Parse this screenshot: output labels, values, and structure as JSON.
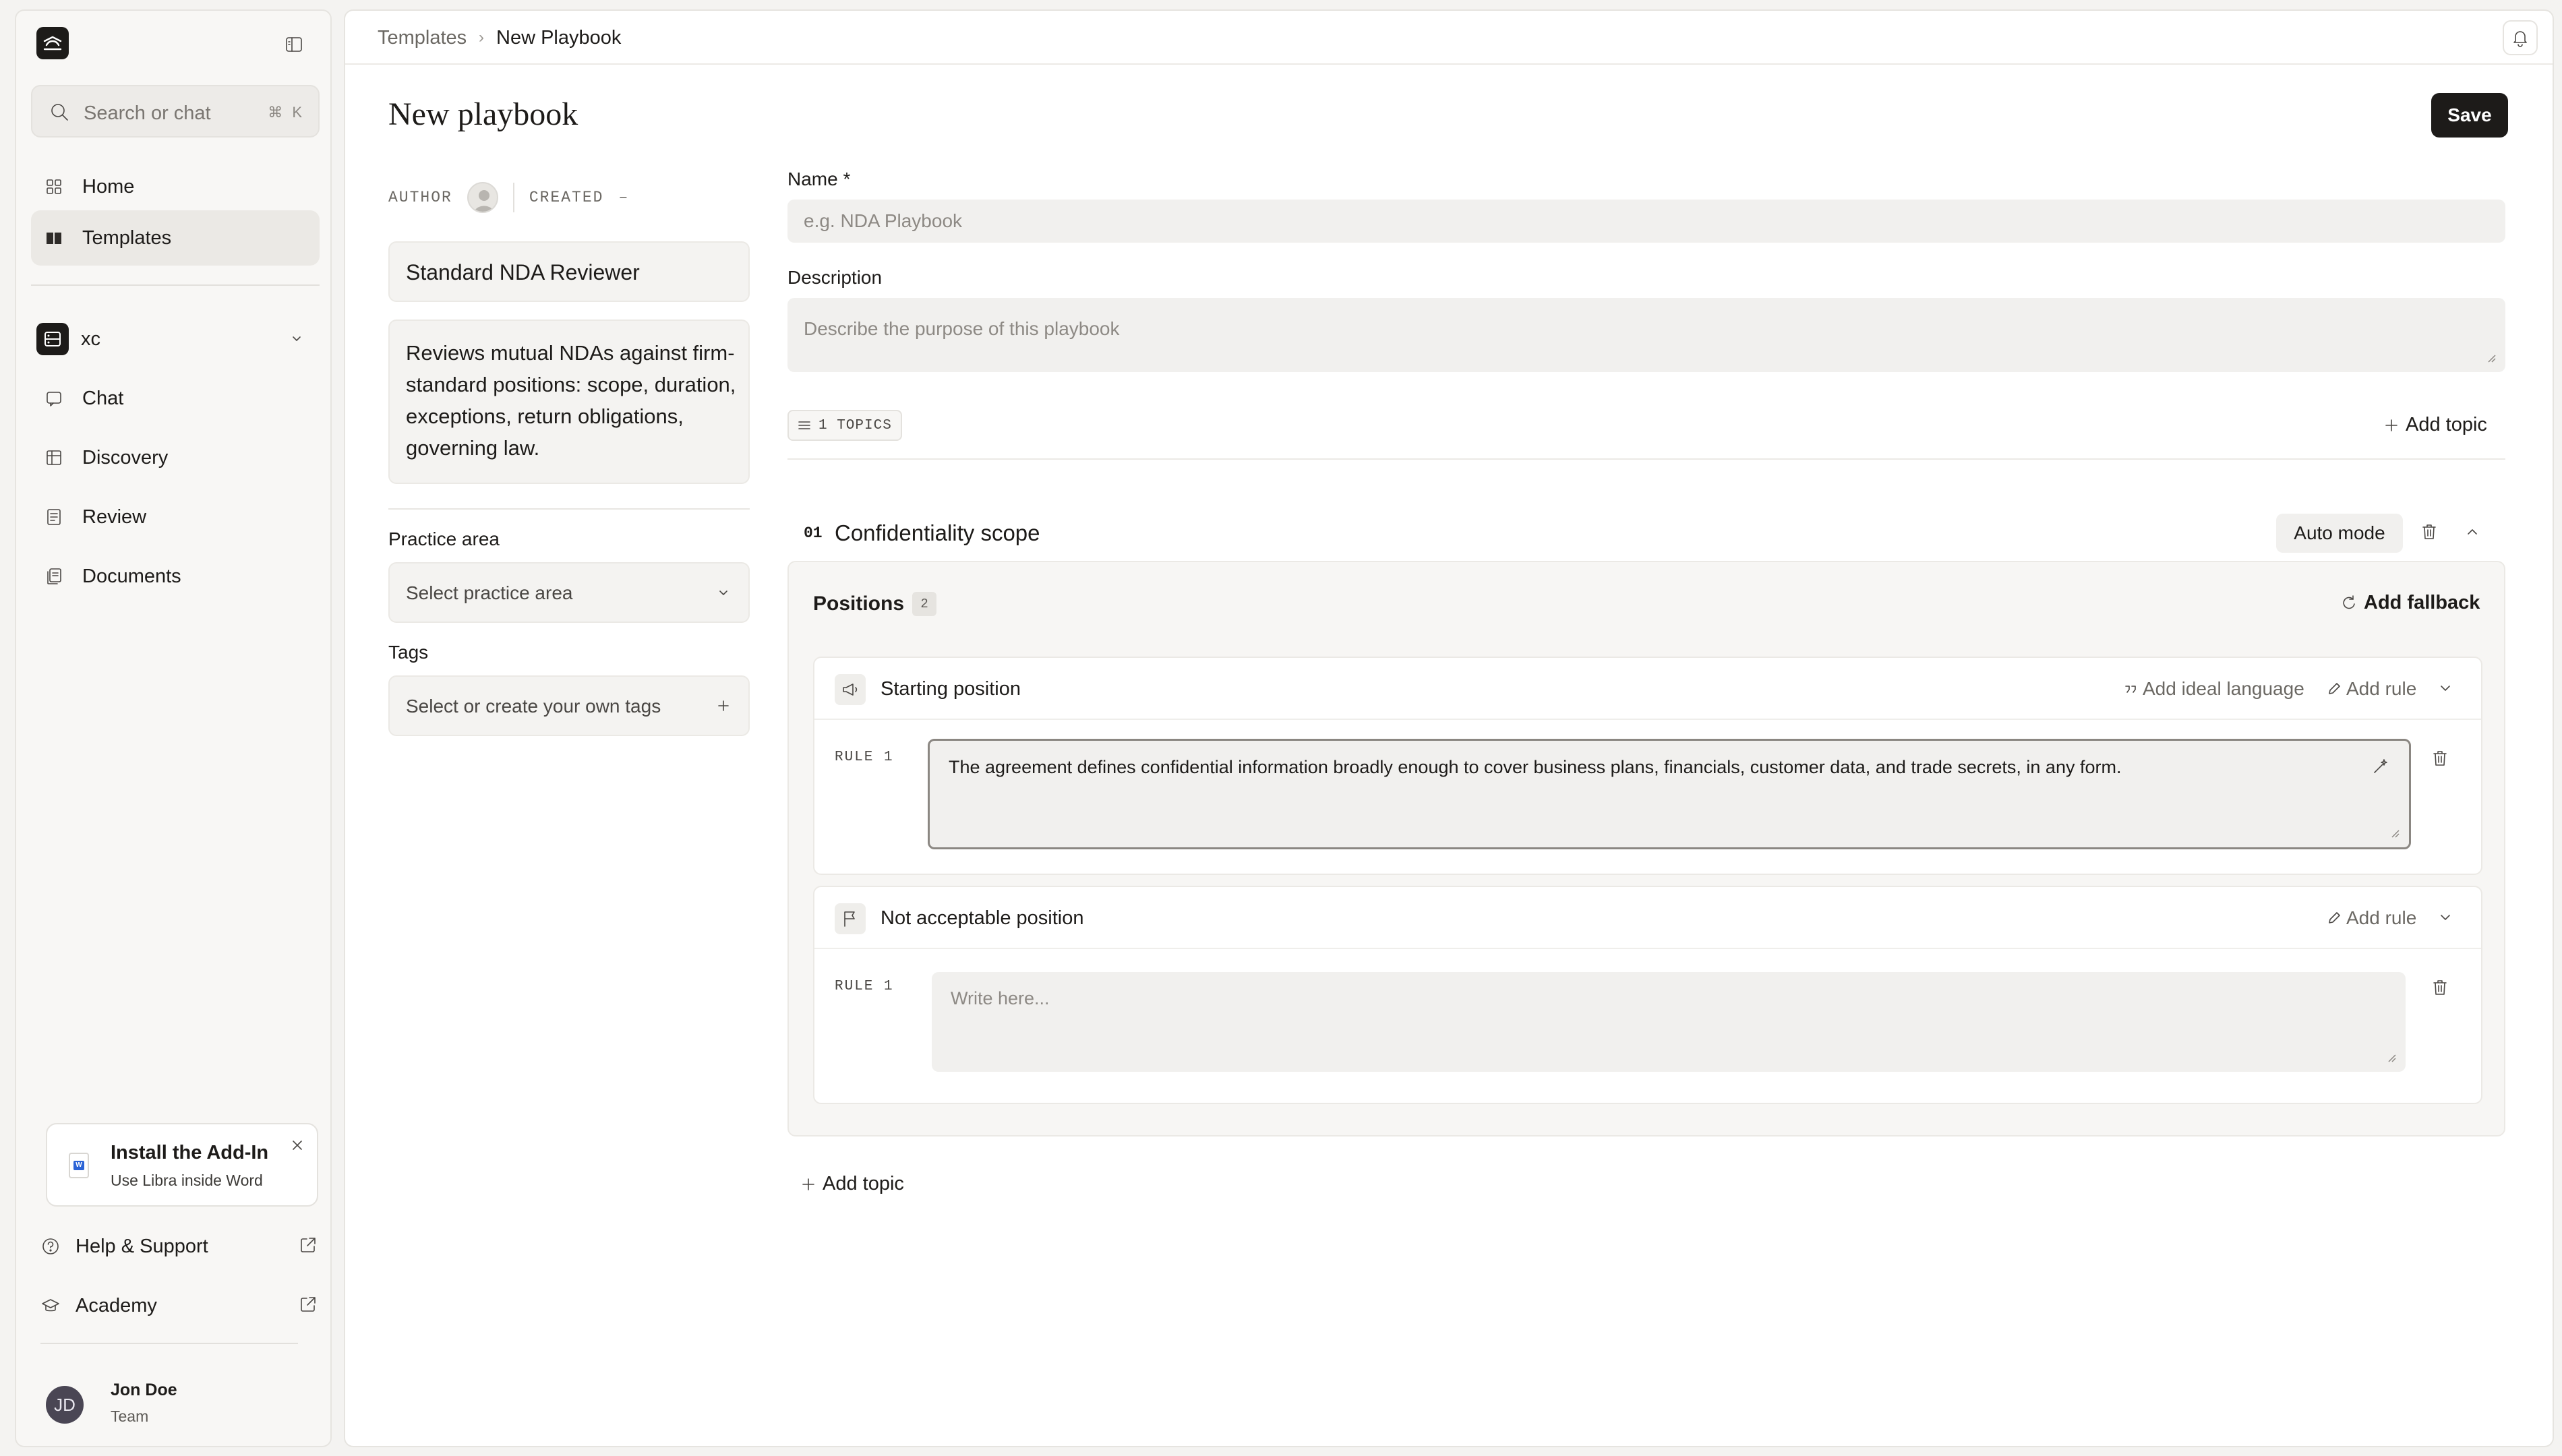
{
  "sidebar": {
    "search_placeholder": "Search or chat",
    "search_shortcut": "⌘ K",
    "nav": [
      {
        "label": "Home",
        "icon": "grid-icon"
      },
      {
        "label": "Templates",
        "icon": "book-icon",
        "active": true
      }
    ],
    "workspace": {
      "label": "xc"
    },
    "workspace_nav": [
      {
        "label": "Chat",
        "icon": "chat-icon"
      },
      {
        "label": "Discovery",
        "icon": "table-icon"
      },
      {
        "label": "Review",
        "icon": "review-icon"
      },
      {
        "label": "Documents",
        "icon": "documents-icon"
      }
    ],
    "addin": {
      "title": "Install the Add-In",
      "subtitle": "Use Libra inside Word"
    },
    "footer": [
      {
        "label": "Help & Support",
        "icon": "help-icon"
      },
      {
        "label": "Academy",
        "icon": "academy-icon"
      }
    ],
    "user": {
      "initials": "JD",
      "name": "Jon Doe",
      "role": "Team"
    }
  },
  "header": {
    "breadcrumb": [
      "Templates",
      "New Playbook"
    ]
  },
  "page": {
    "title": "New playbook",
    "save_label": "Save",
    "author_label": "AUTHOR",
    "created_label": "CREATED",
    "created_value": "–",
    "playbook_name": "Standard NDA Reviewer",
    "playbook_description": "Reviews mutual NDAs against firm-standard positions: scope, duration, exceptions, return obligations, governing law.",
    "practice_area_label": "Practice area",
    "practice_area_placeholder": "Select practice area",
    "tags_label": "Tags",
    "tags_placeholder": "Select or create your own tags"
  },
  "form": {
    "name_label": "Name *",
    "name_placeholder": "e.g. NDA Playbook",
    "description_label": "Description",
    "description_placeholder": "Describe the purpose of this playbook",
    "topics_count": "1 TOPICS",
    "add_topic_label": "Add topic"
  },
  "topic": {
    "number": "01",
    "name": "Confidentiality scope",
    "mode_label": "Auto mode",
    "positions_label": "Positions",
    "positions_count": "2",
    "add_fallback_label": "Add fallback",
    "positions": [
      {
        "title": "Starting position",
        "add_ideal_label": "Add ideal language",
        "add_rule_label": "Add rule",
        "rule_label": "RULE 1",
        "rule_text": "The agreement defines confidential information broadly enough to cover business plans, financials, customer data, and trade secrets, in any form."
      },
      {
        "title": "Not acceptable position",
        "add_rule_label": "Add rule",
        "rule_label": "RULE 1",
        "rule_placeholder": "Write here..."
      }
    ]
  }
}
